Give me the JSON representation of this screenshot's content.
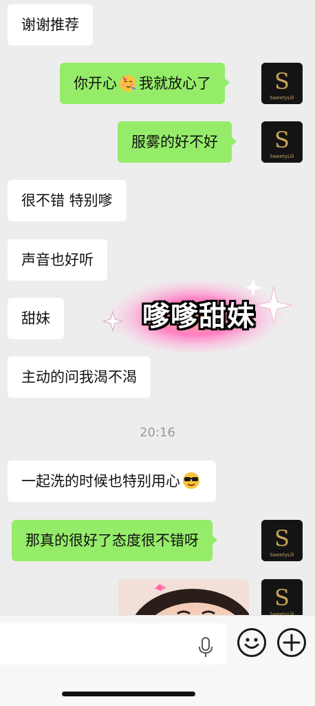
{
  "messages": [
    {
      "text": "谢谢推荐",
      "side": "in"
    },
    {
      "text_before": "你开心",
      "text_after": "我就放心了",
      "emoji": "party-face-emoji",
      "side": "out"
    },
    {
      "text": "服雾的好不好",
      "side": "out"
    },
    {
      "text": "很不错 特别嗲",
      "side": "in"
    },
    {
      "text": "声音也好听",
      "side": "in"
    },
    {
      "text": "甜妹",
      "side": "in"
    },
    {
      "text": "主动的问我渴不渴",
      "side": "in"
    },
    {
      "text_before": "一起洗的时候也特别用心",
      "emoji": "sunglasses-face-emoji",
      "side": "in"
    },
    {
      "text": "那真的很好了态度很不错呀",
      "side": "out"
    }
  ],
  "sticker": {
    "text": "嗲嗲甜妹"
  },
  "timestamp": "20:16",
  "avatar": {
    "brand": "SweetyLili",
    "monogram": "S"
  },
  "icons": [
    "microphone-icon",
    "emoji-icon",
    "plus-icon"
  ],
  "colors": {
    "background": "#ededed",
    "outgoing": "#95ec69",
    "incoming": "#ffffff",
    "sticker_glow": "#ff6fb5"
  }
}
